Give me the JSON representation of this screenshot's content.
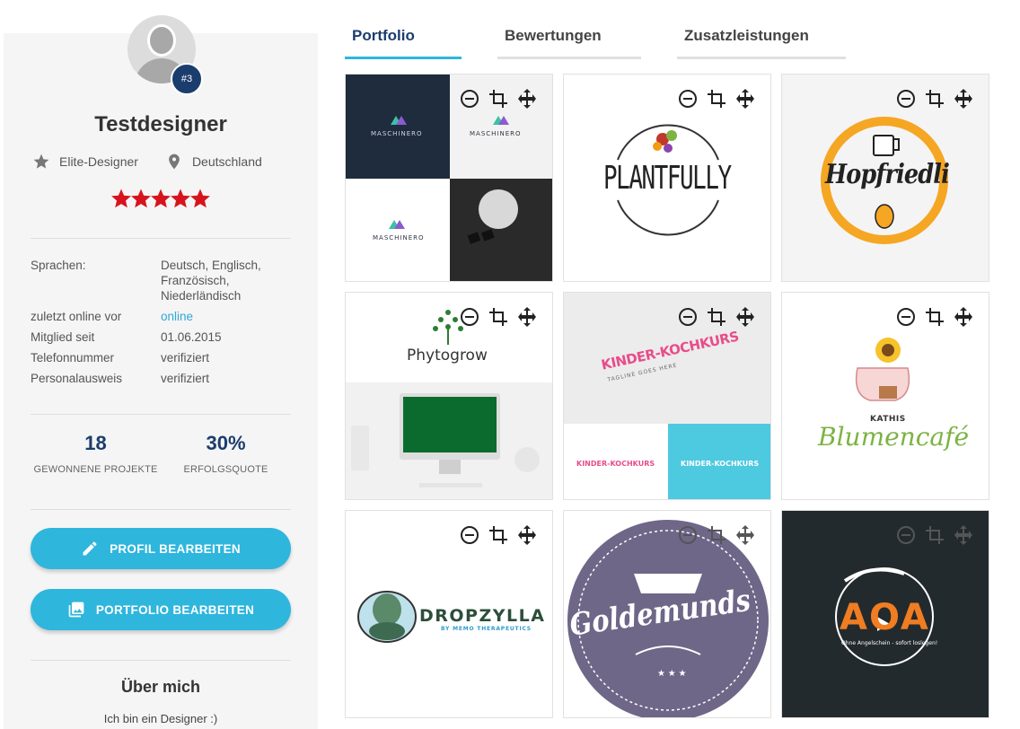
{
  "profile": {
    "rank_badge": "#3",
    "name": "Testdesigner",
    "level": "Elite-Designer",
    "location": "Deutschland",
    "rating_stars": 5,
    "star_color": "#d7141e"
  },
  "details": [
    {
      "label": "Sprachen:",
      "value": "Deutsch, Englisch, Französisch, Niederländisch"
    },
    {
      "label": "zuletzt online vor",
      "value": "online"
    },
    {
      "label": "Mitglied seit",
      "value": "01.06.2015"
    },
    {
      "label": "Telefonnummer",
      "value": "verifiziert"
    },
    {
      "label": "Personalausweis",
      "value": "verifiziert"
    }
  ],
  "stats": {
    "projects_won": "18",
    "projects_won_label": "GEWONNENE PROJEKTE",
    "success_rate": "30%",
    "success_rate_label": "ERFOLGSQUOTE"
  },
  "buttons": {
    "edit_profile": "PROFIL BEARBEITEN",
    "edit_portfolio": "PORTFOLIO BEARBEITEN"
  },
  "about": {
    "title": "Über mich",
    "text": "Ich bin ein Designer :)"
  },
  "tabs": [
    "Portfolio",
    "Bewertungen",
    "Zusatzleistungen"
  ],
  "portfolio": {
    "tiles": [
      {
        "logo": "MASCHINERO"
      },
      {
        "logo": "PLANTFULLY"
      },
      {
        "logo": "Hopfriedli"
      },
      {
        "logo": "Phytogrow"
      },
      {
        "logo": "KINDER-KOCHKURS",
        "tagline": "TAGLINE GOES HERE"
      },
      {
        "logo_small": "KATHIS",
        "logo": "Blumencafé"
      },
      {
        "logo": "DROPZYLLA",
        "tagline": "BY MEMO THERAPEUTICS"
      },
      {
        "logo": "Goldemunds"
      },
      {
        "logo": "AOA",
        "tagline": "Ohne Angelschein - sofort loslegen!"
      }
    ]
  },
  "colors": {
    "accent": "#2eb6dd",
    "navy": "#1b3d6d",
    "link": "#2ea8d8"
  }
}
